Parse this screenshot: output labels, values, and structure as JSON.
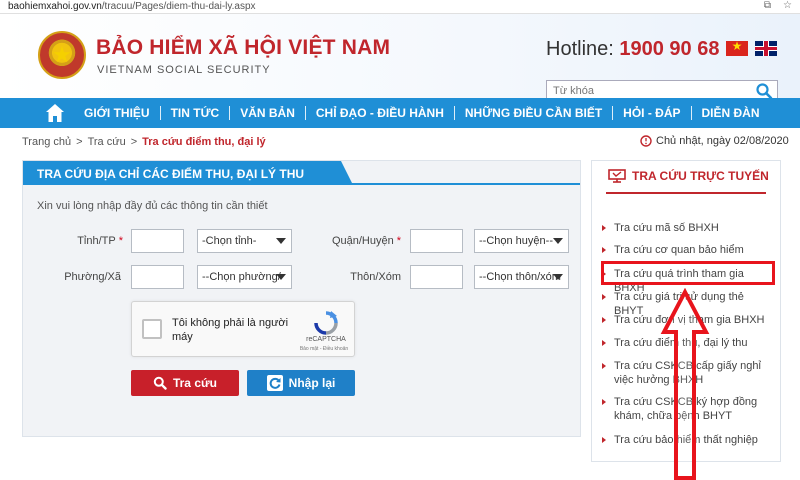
{
  "browser": {
    "url_host": "baohiemxahoi.gov.vn",
    "url_path": "/tracuu/Pages/diem-thu-dai-ly.aspx"
  },
  "header": {
    "title": "BẢO HIỂM XÃ HỘI VIỆT NAM",
    "subtitle": "VIETNAM SOCIAL SECURITY",
    "hotline_label": "Hotline:",
    "hotline_number": "1900 90 68",
    "search_placeholder": "Từ khóa"
  },
  "nav": {
    "items": [
      "GIỚI THIỆU",
      "TIN TỨC",
      "VĂN BẢN",
      "CHỈ ĐẠO - ĐIỀU HÀNH",
      "NHỮNG ĐIỀU CẦN BIẾT",
      "HỎI - ĐÁP",
      "DIỄN ĐÀN"
    ]
  },
  "breadcrumb": {
    "home": "Trang chủ",
    "section": "Tra cứu",
    "current": "Tra cứu điểm thu, đại lý",
    "separator": ">"
  },
  "date": "Chủ nhật, ngày 02/08/2020",
  "form": {
    "title": "TRA CỨU ĐỊA CHỈ CÁC ĐIỂM THU, ĐẠI LÝ THU",
    "instruction": "Xin vui lòng nhập đầy đủ các thông tin cần thiết",
    "required_mark": "*",
    "province_label": "Tỉnh/TP",
    "province_select": "-Chọn tỉnh-",
    "district_label": "Quận/Huyện",
    "district_select": "--Chọn huyện--",
    "ward_label": "Phường/Xã",
    "ward_select": "--Chọn phường/",
    "hamlet_label": "Thôn/Xóm",
    "hamlet_select": "--Chọn thôn/xóm",
    "captcha_text": "Tôi không phải là người máy",
    "captcha_brand": "reCAPTCHA",
    "captcha_links": "Bảo mật - Điều khoản",
    "search_button": "Tra cứu",
    "reset_button": "Nhập lại"
  },
  "sidebar": {
    "title": "TRA CỨU TRỰC TUYẾN",
    "items": [
      "Tra cứu mã số BHXH",
      "Tra cứu cơ quan bảo hiểm",
      "Tra cứu quá trình tham gia BHXH",
      "Tra cứu giá trị sử dụng thẻ BHYT",
      "Tra cứu đơn vị tham gia BHXH",
      "Tra cứu điểm thu, đại lý thu",
      "Tra cứu CSKCB cấp giấy nghỉ việc hưởng BHXH",
      "Tra cứu CSKCB ký hợp đồng khám, chữa bệnh BHYT",
      "Tra cứu bảo hiểm thất nghiệp"
    ],
    "highlighted_index": 2
  },
  "colors": {
    "brand_red": "#c0262c",
    "nav_blue": "#1f8fd6",
    "annotation_red": "#e8141c"
  }
}
